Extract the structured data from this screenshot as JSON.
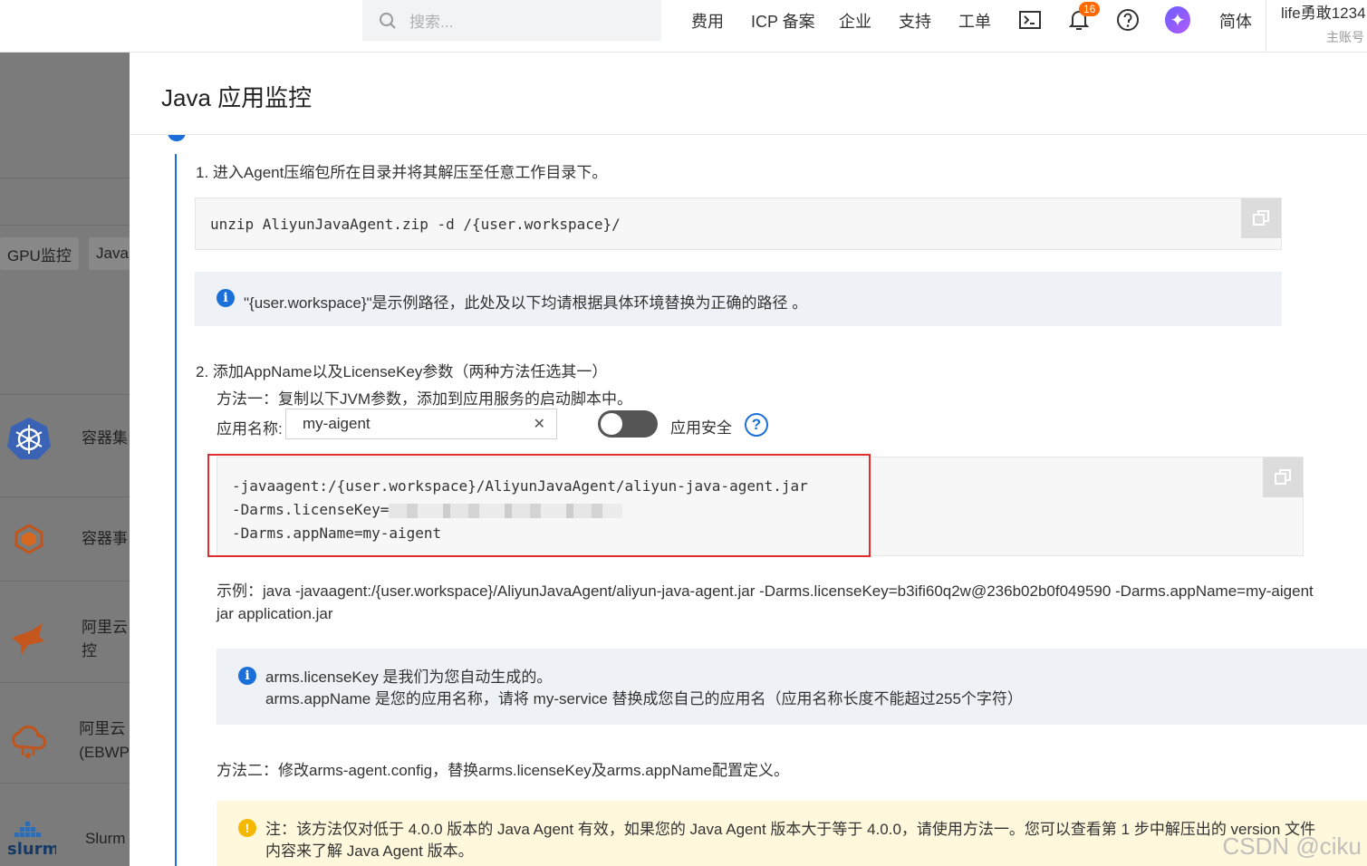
{
  "topbar": {
    "search_placeholder": "搜索...",
    "nav": [
      "费用",
      "ICP 备案",
      "企业",
      "支持",
      "工单"
    ],
    "notifications_count": "16",
    "language": "简体",
    "username": "life勇敢1234",
    "account_type": "主账号"
  },
  "left": {
    "tabs": [
      "GPU监控",
      "Java"
    ],
    "products": [
      {
        "label": "容器集",
        "icon": "kubernetes-icon"
      },
      {
        "label": "容器事",
        "icon": "container-event-icon"
      },
      {
        "label": "阿里云\n控",
        "icon": "monitor-arrow-icon"
      },
      {
        "label": "阿里云\n(EBWP",
        "icon": "cloud-icon"
      },
      {
        "label": "Slurm",
        "icon": "slurm-logo"
      }
    ]
  },
  "panel": {
    "title": "Java 应用监控",
    "step1_text": "1. 进入Agent压缩包所在目录并将其解压至任意工作目录下。",
    "unzip_cmd": "unzip AliyunJavaAgent.zip -d /{user.workspace}/",
    "workspace_note": "\"{user.workspace}\"是示例路径，此处及以下均请根据具体环境替换为正确的路径 。",
    "step2_text": "2. 添加AppName以及LicenseKey参数（两种方法任选其一）",
    "method1_text": "方法一：复制以下JVM参数，添加到应用服务的启动脚本中。",
    "app_name_label": "应用名称:",
    "app_name_value": "my-aigent",
    "security_label": "应用安全",
    "jvm_line1": "-javaagent:/{user.workspace}/AliyunJavaAgent/aliyun-java-agent.jar",
    "jvm_line2": "-Darms.licenseKey=",
    "jvm_line3": "-Darms.appName=my-aigent",
    "example_line1": "示例：java -javaagent:/{user.workspace}/AliyunJavaAgent/aliyun-java-agent.jar -Darms.licenseKey=b3ifi60q2w@236b02b0f049590 -Darms.appName=my-aigent",
    "example_line2": "jar application.jar",
    "info_line1": "arms.licenseKey 是我们为您自动生成的。",
    "info_line2": "arms.appName 是您的应用名称，请将 my-service 替换成您自己的应用名（应用名称长度不能超过255个字符）",
    "method2_text": "方法二：修改arms-agent.config，替换arms.licenseKey及arms.appName配置定义。",
    "warn_line1": "注：该方法仅对低于 4.0.0 版本的 Java Agent 有效，如果您的 Java Agent 版本大于等于 4.0.0，请使用方法一。您可以查看第 1 步中解压出的 version 文件",
    "warn_line2": "内容来了解 Java Agent 版本。"
  },
  "watermark": "CSDN @ciku"
}
